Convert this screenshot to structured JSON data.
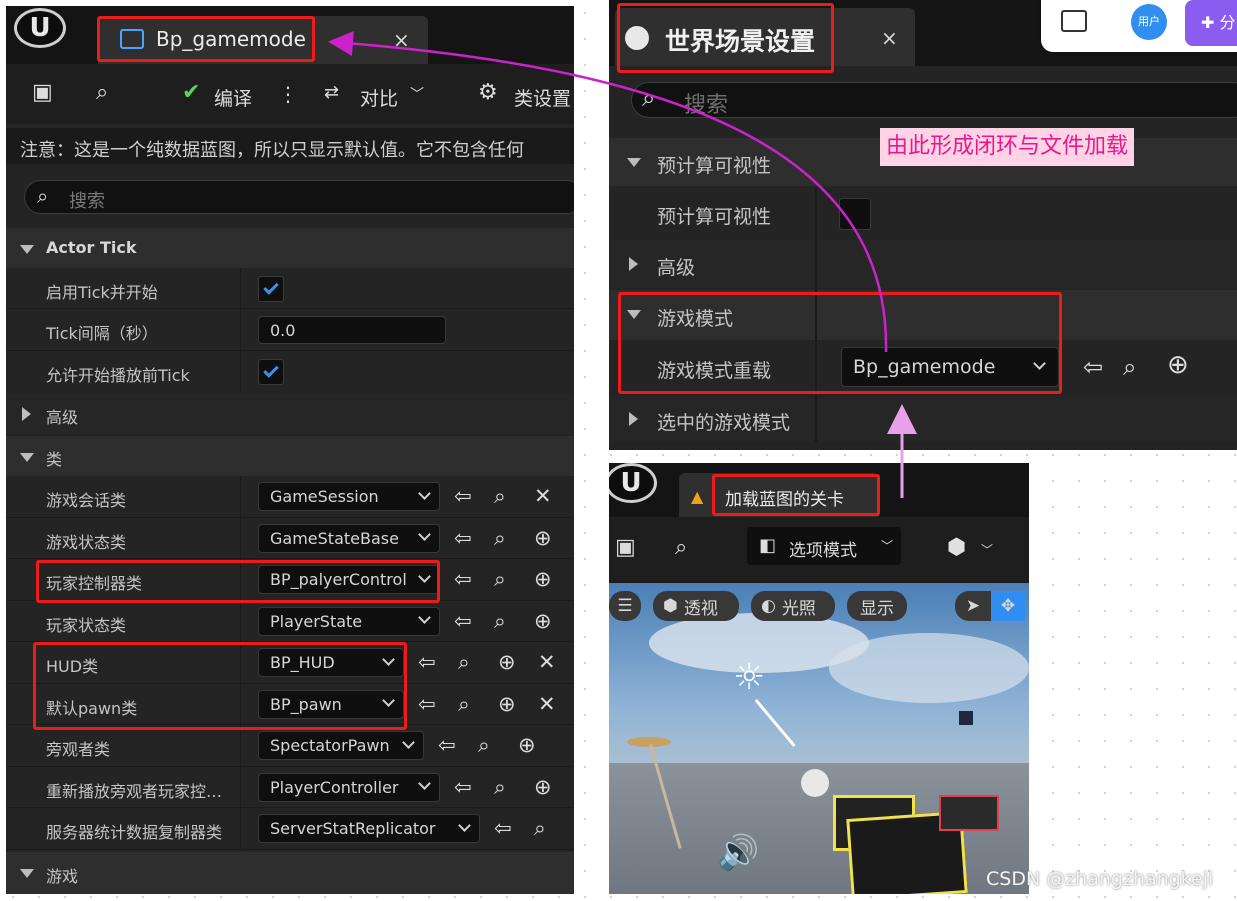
{
  "left_panel": {
    "tab_title": "Bp_gamemode",
    "toolbar": {
      "compile_label": "编译",
      "diff_label": "对比",
      "class_settings_label": "类设置"
    },
    "notice": "注意：这是一个纯数据蓝图，所以只显示默认值。它不包含任何",
    "search_placeholder": "搜索",
    "sections": {
      "actor_tick": "Actor Tick",
      "advanced": "高级",
      "classes": "类",
      "game": "游戏"
    },
    "tick_rows": [
      {
        "label": "启用Tick并开始",
        "kind": "checkbox"
      },
      {
        "label": "Tick间隔（秒）",
        "value": "0.0"
      },
      {
        "label": "允许开始播放前Tick",
        "kind": "checkbox"
      }
    ],
    "class_rows": [
      {
        "label": "游戏会话类",
        "value": "GameSession"
      },
      {
        "label": "游戏状态类",
        "value": "GameStateBase"
      },
      {
        "label": "玩家控制器类",
        "value": "BP_palyerControl"
      },
      {
        "label": "玩家状态类",
        "value": "PlayerState"
      },
      {
        "label": "HUD类",
        "value": "BP_HUD"
      },
      {
        "label": "默认pawn类",
        "value": "BP_pawn"
      },
      {
        "label": "旁观者类",
        "value": "SpectatorPawn"
      },
      {
        "label": "重新播放旁观者玩家控…",
        "value": "PlayerController"
      },
      {
        "label": "服务器统计数据复制器类",
        "value": "ServerStatReplicator"
      }
    ]
  },
  "right_panel": {
    "tab_title": "世界场景设置",
    "search_placeholder": "搜索",
    "annotation": "由此形成闭环与文件加载",
    "rows": {
      "precompute_section": "预计算可视性",
      "precompute_label": "预计算可视性",
      "advanced": "高级",
      "game_mode_section": "游戏模式",
      "game_mode_override_label": "游戏模式重载",
      "game_mode_override_value": "Bp_gamemode",
      "selected_game_mode": "选中的游戏模式"
    }
  },
  "top_bar": {
    "user_label": "用户",
    "share_label": "分"
  },
  "viewport_panel": {
    "tab_title": "加载蓝图的关卡",
    "mode_label": "选项模式",
    "perspective_label": "透视",
    "lighting_label": "光照",
    "show_label": "显示"
  },
  "watermark": "CSDN @zhangzhangkeji",
  "colors": {
    "highlight_red": "#ee1b1b",
    "arrow_magenta": "#cc22cc",
    "accent_blue": "#3d8fe8",
    "annotation_pink": "#e9188c"
  }
}
